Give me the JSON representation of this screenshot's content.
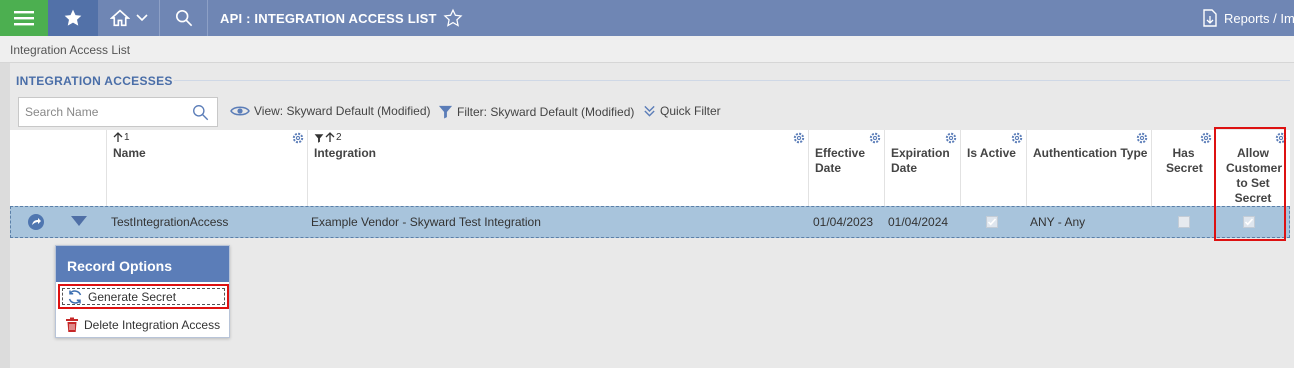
{
  "header": {
    "page_title": "API : INTEGRATION ACCESS LIST",
    "reports_label": "Reports / Im"
  },
  "breadcrumb": "Integration Access List",
  "section": {
    "title": "INTEGRATION ACCESSES"
  },
  "toolbar": {
    "search_placeholder": "Search Name",
    "view_label": "View: Skyward Default (Modified)",
    "filter_label": "Filter: Skyward Default (Modified)",
    "quick_filter_label": "Quick Filter"
  },
  "grid": {
    "columns": {
      "name": {
        "label": "Name",
        "sort_order": "1"
      },
      "integration": {
        "label": "Integration",
        "sort_order": "2"
      },
      "effective_date": "Effective Date",
      "expiration_date": "Expiration Date",
      "is_active": "Is Active",
      "authentication_type": "Authentication Type",
      "has_secret": "Has Secret",
      "allow_customer_set_secret": "Allow Customer to Set Secret"
    },
    "rows": [
      {
        "name": "TestIntegrationAccess",
        "integration": "Example Vendor - Skyward Test Integration",
        "effective_date": "01/04/2023",
        "expiration_date": "01/04/2024",
        "is_active": true,
        "authentication_type": "ANY - Any",
        "has_secret": false,
        "allow_customer_set_secret": true
      }
    ]
  },
  "record_options": {
    "title": "Record Options",
    "generate_secret": "Generate Secret",
    "delete_integration_access": "Delete Integration Access"
  },
  "colors": {
    "topbar": "#6f86b4",
    "menu_button": "#4caf50",
    "selected_row": "#a8c4dc",
    "accent": "#4a6ea8",
    "highlight": "#dd1111"
  }
}
